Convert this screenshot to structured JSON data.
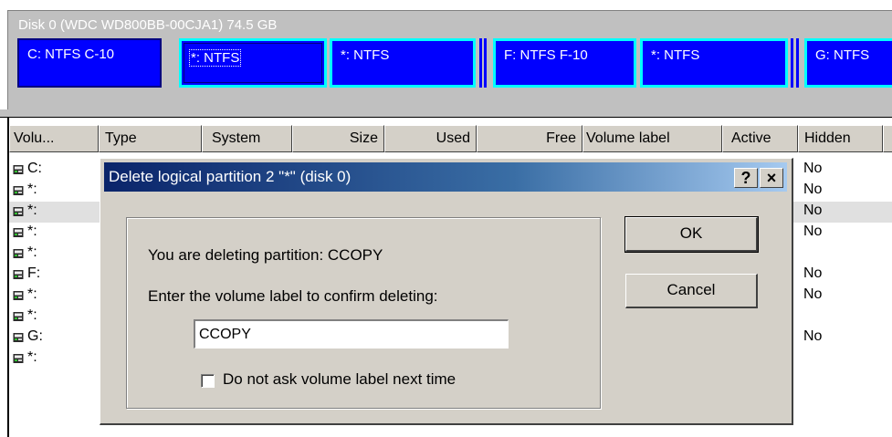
{
  "disk_map": {
    "title": "Disk 0 (WDC WD800BB-00CJA1) 74.5 GB",
    "partitions": [
      {
        "label": "C: NTFS  C-10"
      },
      {
        "label": "*: NTFS"
      },
      {
        "label": "*: NTFS"
      },
      {
        "label": "F: NTFS  F-10"
      },
      {
        "label": "*: NTFS"
      },
      {
        "label": "G: NTFS"
      }
    ]
  },
  "list": {
    "headers": [
      "Volu...",
      "Type",
      "System",
      "Size",
      "Used",
      "Free",
      "Volume label",
      "Active",
      "Hidden"
    ],
    "rows": [
      {
        "volume": "C:",
        "hidden": "No"
      },
      {
        "volume": "*:",
        "hidden": "No"
      },
      {
        "volume": "*:",
        "hidden": "No"
      },
      {
        "volume": "*:",
        "hidden": "No"
      },
      {
        "volume": "*:",
        "hidden": ""
      },
      {
        "volume": "F:",
        "hidden": "No"
      },
      {
        "volume": "*:",
        "hidden": "No"
      },
      {
        "volume": "*:",
        "hidden": ""
      },
      {
        "volume": "G:",
        "hidden": "No"
      },
      {
        "volume": "*:",
        "hidden": ""
      }
    ]
  },
  "dialog": {
    "title": "Delete logical partition 2  \"*\" (disk 0)",
    "help_glyph": "?",
    "close_glyph": "×",
    "message": "You are deleting partition:  CCOPY",
    "prompt": "Enter the volume label to confirm deleting:",
    "input_value": "CCOPY",
    "checkbox_label": "Do not ask volume label next time",
    "checkbox_checked": false,
    "ok_label": "OK",
    "cancel_label": "Cancel"
  },
  "colors": {
    "partition_fill": "#0000ff",
    "partition_selected_border": "#00ffff",
    "dialog_title_gradient_start": "#0a246a",
    "dialog_title_gradient_end": "#a6caf0"
  }
}
